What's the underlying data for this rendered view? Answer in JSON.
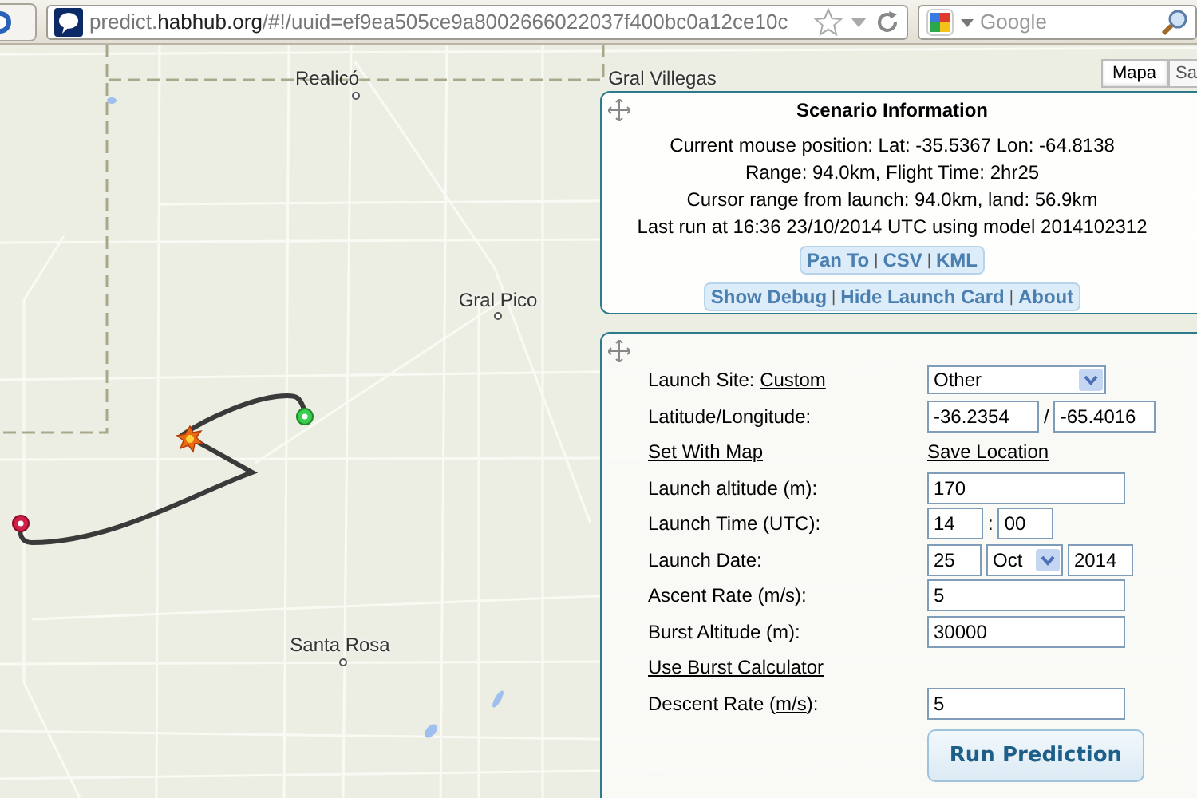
{
  "browser": {
    "url": "predict.**habhub.org**/#!/uuid=ef9ea505ce9a8002666022037f400bc0a12ce10c",
    "search": {
      "placeholder": "Google"
    }
  },
  "map": {
    "labels": [
      {
        "text": "Realicó",
        "kind": "town"
      },
      {
        "text": "Gral Villegas",
        "kind": "town"
      },
      {
        "text": "Gral Pico",
        "kind": "town"
      },
      {
        "text": "Santa Rosa",
        "kind": "town"
      }
    ],
    "map_types": [
      {
        "label": "Mapa",
        "selected": true
      },
      {
        "label": "Sa",
        "selected": false
      }
    ]
  },
  "scenario": {
    "title": "Scenario Information",
    "lines": [
      "Current mouse position: Lat: -35.5367 Lon: -64.8138",
      "Range: 94.0km, Flight Time: 2hr25",
      "Cursor range from launch: 94.0km, land: 56.9km",
      "Last run at 16:36 23/10/2014 UTC using model 2014102312"
    ],
    "link_groups": [
      [
        {
          "kind": "link",
          "text": "Pan To"
        },
        {
          "kind": "sep",
          "text": "|"
        },
        {
          "kind": "link",
          "text": "CSV"
        },
        {
          "kind": "sep",
          "text": "|"
        },
        {
          "kind": "link",
          "text": "KML"
        }
      ],
      [
        {
          "kind": "link",
          "text": "Show Debug"
        },
        {
          "kind": "sep",
          "text": "|"
        },
        {
          "kind": "link",
          "text": "Hide Launch Card"
        },
        {
          "kind": "sep",
          "text": "|"
        },
        {
          "kind": "link",
          "text": "About"
        }
      ]
    ]
  },
  "launch_card": {
    "rows": [
      {
        "kind": "select",
        "label": "Launch Site: ",
        "link": "Custom",
        "value": "Other"
      },
      {
        "kind": "pair",
        "label": "Latitude/Longitude:",
        "values": [
          "-36.2354",
          "-65.4016"
        ],
        "separator": "/"
      },
      {
        "kind": "links",
        "links": [
          "Set With Map",
          "Save Location"
        ]
      },
      {
        "kind": "input",
        "label": "Launch altitude (m):",
        "value": "170"
      },
      {
        "kind": "time",
        "label": "Launch Time (UTC):",
        "values": [
          "14",
          "00"
        ],
        "separator": ":"
      },
      {
        "kind": "date",
        "label": "Launch Date:",
        "day": "25",
        "month": "Oct",
        "year": "2014"
      },
      {
        "kind": "input",
        "label": "Ascent Rate (m/s):",
        "value": "5"
      },
      {
        "kind": "input",
        "label": "Burst Altitude (m):",
        "value": "30000"
      },
      {
        "kind": "links",
        "links": [
          "Use Burst Calculator"
        ]
      },
      {
        "kind": "input",
        "label": "Descent Rate (",
        "link": "m/s",
        "label_after": "):",
        "value": "5"
      }
    ],
    "button": "Run Prediction"
  }
}
